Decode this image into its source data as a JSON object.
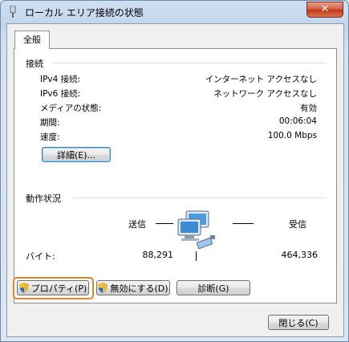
{
  "window": {
    "title": "ローカル エリア接続の状態",
    "close_symbol": "✕"
  },
  "tab": {
    "label": "全般"
  },
  "connection": {
    "heading": "接続",
    "rows": [
      {
        "label": "IPv4 接続:",
        "value": "インターネット アクセスなし"
      },
      {
        "label": "IPv6 接続:",
        "value": "ネットワーク アクセスなし"
      },
      {
        "label": "メディアの状態:",
        "value": "有効"
      },
      {
        "label": "期間:",
        "value": "00:06:04"
      },
      {
        "label": "速度:",
        "value": "100.0 Mbps"
      }
    ],
    "details_button": "詳細(E)..."
  },
  "activity": {
    "heading": "動作状況",
    "sent_label": "送信",
    "received_label": "受信",
    "bytes_label": "バイト:",
    "sent_bytes": "88,291",
    "received_bytes": "464,336"
  },
  "buttons": {
    "properties": "プロパティ(P)",
    "disable": "無効にする(D)",
    "diagnose": "診断(G)",
    "close": "閉じる(C)"
  },
  "colors": {
    "highlight": "#e8842a",
    "shield_blue": "#2f6fbf",
    "shield_yellow": "#f2c12e"
  }
}
